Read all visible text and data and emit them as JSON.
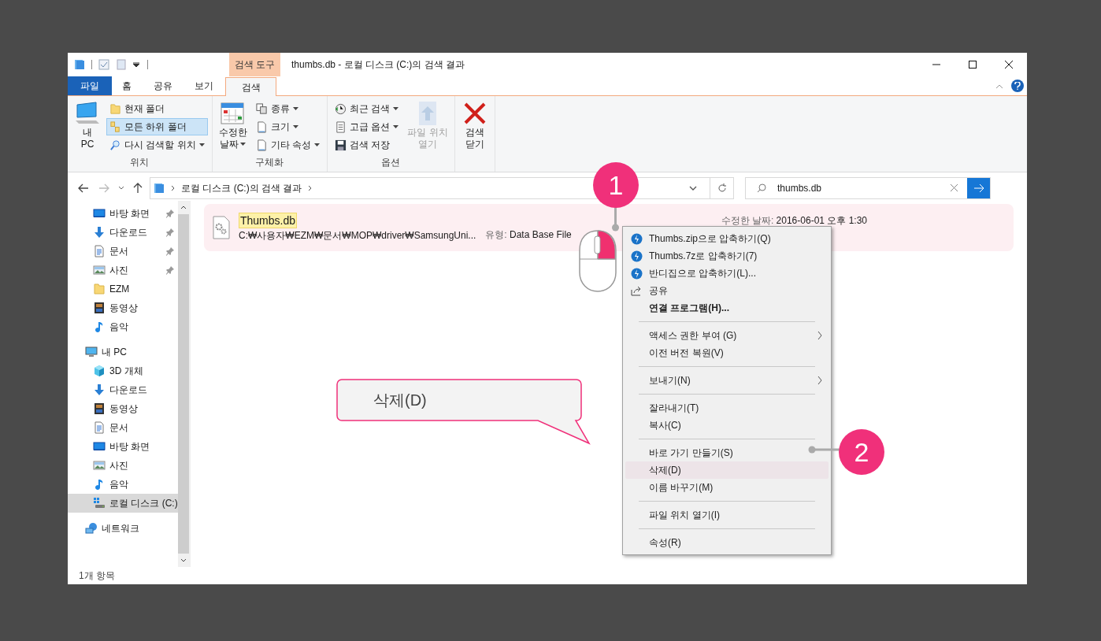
{
  "title_bar": {
    "contextual_tab": "검색 도구",
    "title": "thumbs.db - 로컬 디스크 (C:)의 검색 결과"
  },
  "ribbon_tabs": [
    {
      "label": "파일",
      "kind": "file",
      "selected": false
    },
    {
      "label": "홈",
      "kind": "tab",
      "selected": false
    },
    {
      "label": "공유",
      "kind": "tab",
      "selected": false
    },
    {
      "label": "보기",
      "kind": "tab",
      "selected": false
    },
    {
      "label": "검색",
      "kind": "tab",
      "selected": true
    }
  ],
  "ribbon_groups": [
    {
      "label": "위치",
      "items": [
        {
          "kind": "large",
          "lines": [
            "내",
            "PC"
          ],
          "dropdown": false,
          "disabled": false
        },
        {
          "kind": "column",
          "items": [
            {
              "label": "현재 폴더",
              "selected": false,
              "dropdown": false
            },
            {
              "label": "모든 하위 폴더",
              "selected": true,
              "dropdown": false
            },
            {
              "label": "다시 검색할 위치",
              "selected": false,
              "dropdown": true
            }
          ]
        }
      ]
    },
    {
      "label": "구체화",
      "items": [
        {
          "kind": "large",
          "lines": [
            "수정한",
            "날짜"
          ],
          "dropdown": true,
          "disabled": false
        },
        {
          "kind": "column",
          "items": [
            {
              "label": "종류",
              "selected": false,
              "dropdown": true
            },
            {
              "label": "크기",
              "selected": false,
              "dropdown": true
            },
            {
              "label": "기타 속성",
              "selected": false,
              "dropdown": true
            }
          ]
        }
      ]
    },
    {
      "label": "옵션",
      "items": [
        {
          "kind": "column",
          "items": [
            {
              "label": "최근 검색",
              "selected": false,
              "dropdown": true
            },
            {
              "label": "고급 옵션",
              "selected": false,
              "dropdown": true
            },
            {
              "label": "검색 저장",
              "selected": false,
              "dropdown": false
            }
          ]
        },
        {
          "kind": "large",
          "lines": [
            "파일 위치",
            "열기"
          ],
          "dropdown": false,
          "disabled": true
        }
      ]
    },
    {
      "items": [
        {
          "kind": "large",
          "lines": [
            "검색",
            "닫기"
          ],
          "dropdown": false,
          "disabled": false
        }
      ]
    }
  ],
  "address": {
    "path": "로컬 디스크 (C:)의 검색 결과"
  },
  "search": {
    "value": "thumbs.db"
  },
  "sidebar": {
    "quick_access": [
      {
        "label": "바탕 화면",
        "pinned": true
      },
      {
        "label": "다운로드",
        "pinned": true
      },
      {
        "label": "문서",
        "pinned": true
      },
      {
        "label": "사진",
        "pinned": true
      },
      {
        "label": "EZM",
        "pinned": false
      },
      {
        "label": "동영상",
        "pinned": false
      },
      {
        "label": "음악",
        "pinned": false
      }
    ],
    "this_pc": {
      "label": "내 PC",
      "children": [
        {
          "label": "3D 개체",
          "selected": false
        },
        {
          "label": "다운로드",
          "selected": false
        },
        {
          "label": "동영상",
          "selected": false
        },
        {
          "label": "문서",
          "selected": false
        },
        {
          "label": "바탕 화면",
          "selected": false
        },
        {
          "label": "사진",
          "selected": false
        },
        {
          "label": "음악",
          "selected": false
        },
        {
          "label": "로컬 디스크 (C:)",
          "selected": true
        }
      ]
    },
    "network": {
      "label": "네트워크"
    }
  },
  "results": [
    {
      "name": "Thumbs.db",
      "path": "C:₩사용자₩EZM₩문서₩MOP₩driver₩SamsungUni...",
      "type_label": "유형:",
      "type": "Data Base File",
      "date_label": "수정한 날짜:",
      "date": "2016-06-01 오후 1:30",
      "selected": true
    }
  ],
  "context_menu": [
    {
      "kind": "item",
      "label": "Thumbs.zip으로 압축하기(Q)",
      "icon": true,
      "bold": false,
      "submenu": false,
      "selected": false
    },
    {
      "kind": "item",
      "label": "Thumbs.7z로 압축하기(7)",
      "icon": true,
      "bold": false,
      "submenu": false,
      "selected": false
    },
    {
      "kind": "item",
      "label": "반디집으로 압축하기(L)...",
      "icon": true,
      "bold": false,
      "submenu": false,
      "selected": false
    },
    {
      "kind": "item",
      "label": "공유",
      "icon": true,
      "bold": false,
      "submenu": false,
      "selected": false
    },
    {
      "kind": "item",
      "label": "연결 프로그램(H)...",
      "icon": false,
      "bold": true,
      "submenu": false,
      "selected": false
    },
    {
      "kind": "separator"
    },
    {
      "kind": "item",
      "label": "액세스 권한 부여 (G)",
      "icon": false,
      "bold": false,
      "submenu": true,
      "selected": false
    },
    {
      "kind": "item",
      "label": "이전 버전 복원(V)",
      "icon": false,
      "bold": false,
      "submenu": false,
      "selected": false
    },
    {
      "kind": "separator"
    },
    {
      "kind": "item",
      "label": "보내기(N)",
      "icon": false,
      "bold": false,
      "submenu": true,
      "selected": false
    },
    {
      "kind": "separator"
    },
    {
      "kind": "item",
      "label": "잘라내기(T)",
      "icon": false,
      "bold": false,
      "submenu": false,
      "selected": false
    },
    {
      "kind": "item",
      "label": "복사(C)",
      "icon": false,
      "bold": false,
      "submenu": false,
      "selected": false
    },
    {
      "kind": "separator"
    },
    {
      "kind": "item",
      "label": "바로 가기 만들기(S)",
      "icon": false,
      "bold": false,
      "submenu": false,
      "selected": false
    },
    {
      "kind": "item",
      "label": "삭제(D)",
      "icon": false,
      "bold": false,
      "submenu": false,
      "selected": true
    },
    {
      "kind": "item",
      "label": "이름 바꾸기(M)",
      "icon": false,
      "bold": false,
      "submenu": false,
      "selected": false
    },
    {
      "kind": "separator"
    },
    {
      "kind": "item",
      "label": "파일 위치 열기(I)",
      "icon": false,
      "bold": false,
      "submenu": false,
      "selected": false
    },
    {
      "kind": "separator"
    },
    {
      "kind": "item",
      "label": "속성(R)",
      "icon": false,
      "bold": false,
      "submenu": false,
      "selected": false
    }
  ],
  "annotations": {
    "markers": [
      "1",
      "2"
    ],
    "callout": "삭제(D)"
  },
  "status_bar": {
    "count": "1개 항목"
  }
}
